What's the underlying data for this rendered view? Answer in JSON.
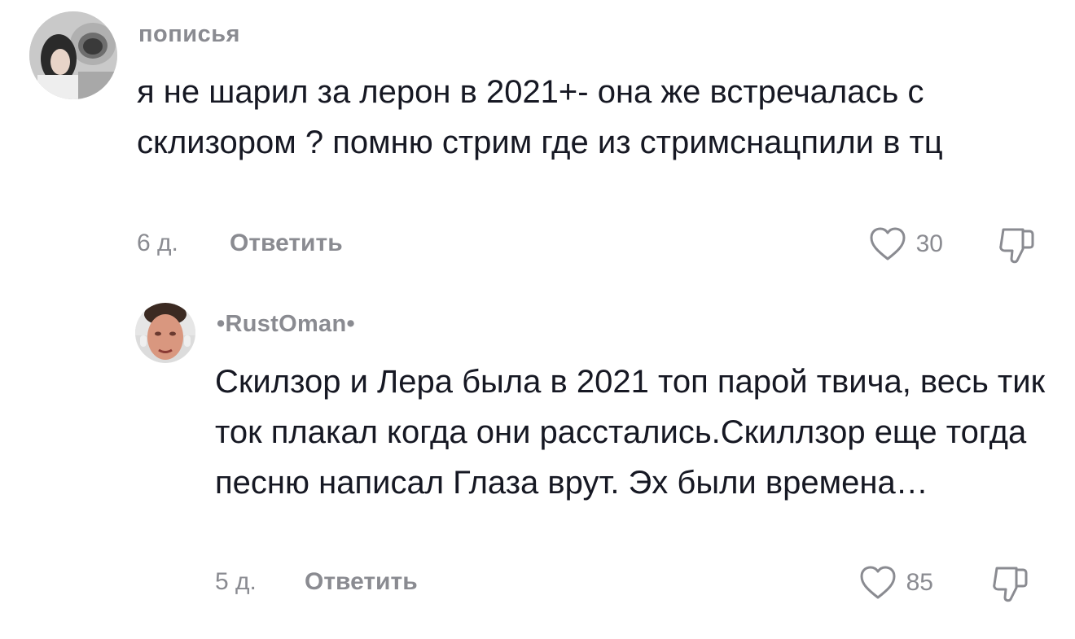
{
  "comments": [
    {
      "username": "пописья",
      "text": "я не шарил за лерон в 2021+- она же встречалась с склизором ? помню стрим где из стримснацпили в тц",
      "date": "6 д.",
      "reply_label": "Ответить",
      "likes": "30"
    },
    {
      "username": "•RustOman•",
      "text": "Скилзор и Лера была в 2021 топ парой твича, весь тик ток плакал когда они расстались.Скиллзор еще тогда песню написал Глаза врут. Эх были времена…",
      "date": "5 д.",
      "reply_label": "Ответить",
      "likes": "85"
    }
  ],
  "icons": {
    "like": "heart-outline-icon",
    "dislike": "thumbs-down-outline-icon"
  },
  "colors": {
    "text": "#161823",
    "muted": "#8a8b91",
    "background": "#ffffff"
  }
}
